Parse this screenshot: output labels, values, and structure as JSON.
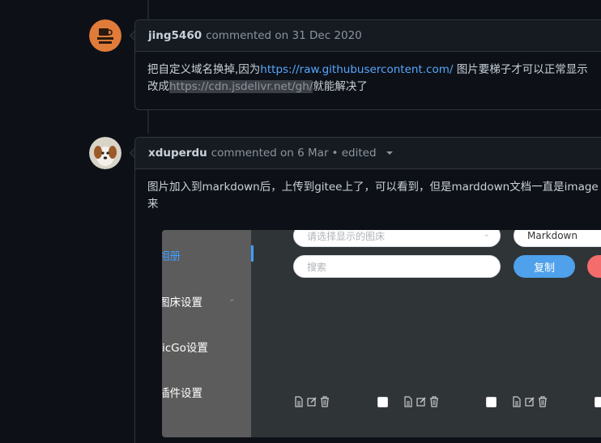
{
  "comments": [
    {
      "author": "jing5460",
      "meta": "commented on 31 Dec 2020",
      "body_line1_prefix": "把自定义域名换掉,因为",
      "body_link": "https://raw.githubusercontent.com/",
      "body_line1_suffix": " 图片要梯子才可以正常显示",
      "body_line2_prefix": "改成",
      "body_code": "https://cdn.jsdelivr.net/gh/",
      "body_line2_suffix": "就能解决了"
    },
    {
      "author": "xduperdu",
      "meta": "commented on 6 Mar",
      "edited": "• edited",
      "body_line1": "图片加入到markdown后，上传到gitee上了，可以看到，但是marddown文档一直是image lo",
      "body_line2": "来"
    }
  ],
  "screenshot": {
    "sidebar": [
      "相册",
      "图床设置",
      "icGo设置",
      "插件设置"
    ],
    "select_placeholder": "请选择显示的图床",
    "format_value": "Markdown",
    "search_placeholder": "搜索",
    "copy_label": "复制"
  },
  "colors": {
    "background": "#0d1117",
    "link": "#58a6ff",
    "border": "#30363d",
    "accent_blue": "#409eff"
  }
}
